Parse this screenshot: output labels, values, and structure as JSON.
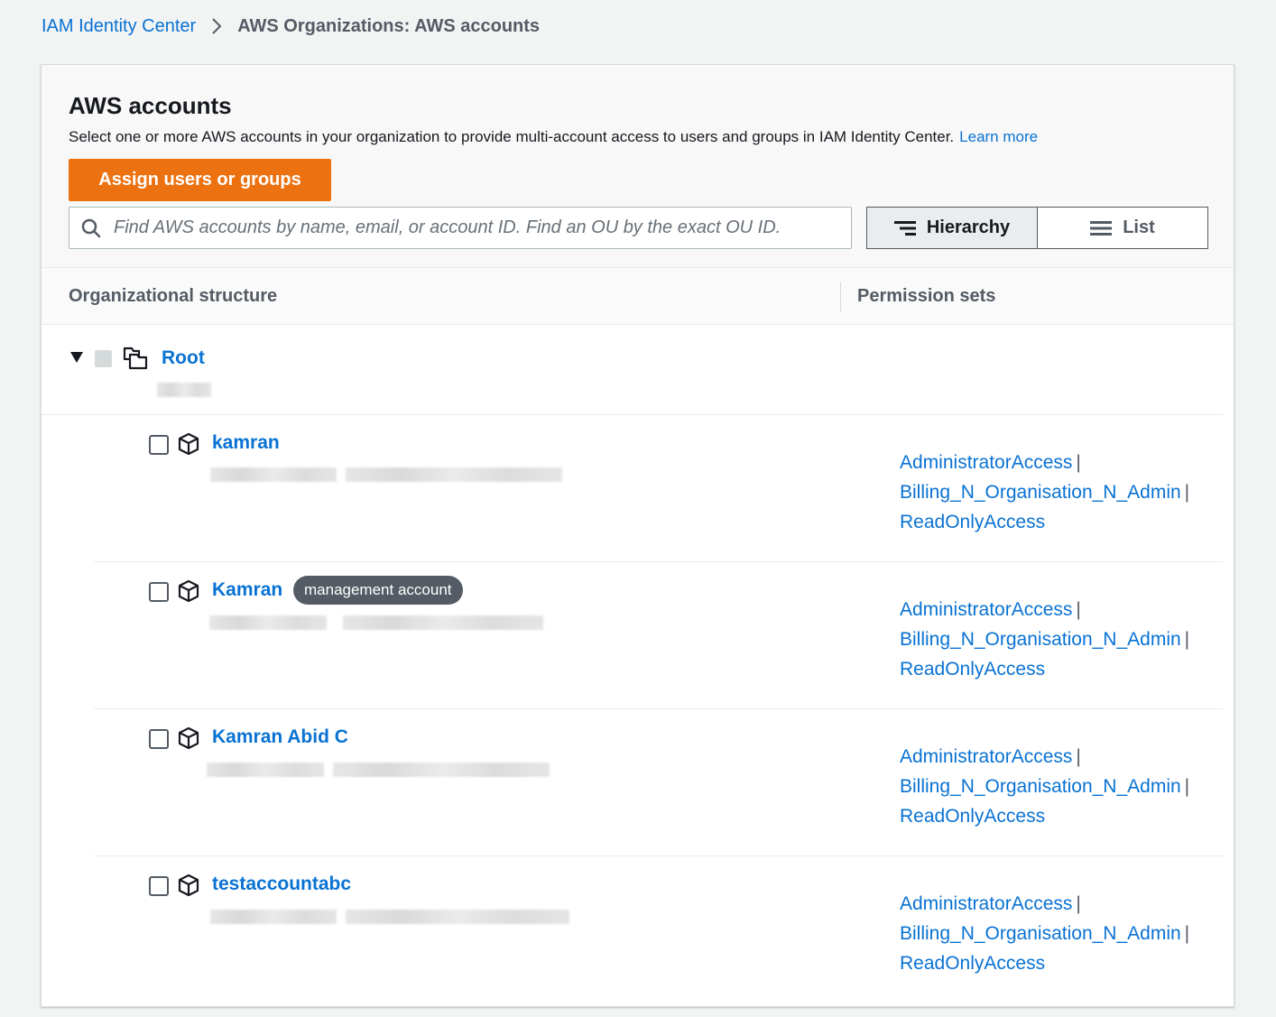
{
  "breadcrumb": {
    "root": "IAM Identity Center",
    "current": "AWS Organizations: AWS accounts"
  },
  "panel": {
    "title": "AWS accounts",
    "description": "Select one or more AWS accounts in your organization to provide multi-account access to users and groups in IAM Identity Center.",
    "learn_more": "Learn more",
    "assign_button": "Assign users or groups",
    "search_placeholder": "Find AWS accounts by name, email, or account ID. Find an OU by the exact OU ID.",
    "view_toggle": {
      "hierarchy": "Hierarchy",
      "list": "List",
      "selected": "Hierarchy"
    }
  },
  "columns": {
    "org_structure": "Organizational structure",
    "permission_sets": "Permission sets"
  },
  "root": {
    "name": "Root",
    "expanded": true
  },
  "accounts": [
    {
      "name": "kamran",
      "badge": "",
      "permission_sets": [
        "AdministratorAccess",
        "Billing_N_Organisation_N_Admin",
        "ReadOnlyAccess"
      ]
    },
    {
      "name": "Kamran",
      "badge": "management account",
      "permission_sets": [
        "AdministratorAccess",
        "Billing_N_Organisation_N_Admin",
        "ReadOnlyAccess"
      ]
    },
    {
      "name": "Kamran Abid C",
      "badge": "",
      "permission_sets": [
        "AdministratorAccess",
        "Billing_N_Organisation_N_Admin",
        "ReadOnlyAccess"
      ]
    },
    {
      "name": "testaccountabc",
      "badge": "",
      "permission_sets": [
        "AdministratorAccess",
        "Billing_N_Organisation_N_Admin",
        "ReadOnlyAccess"
      ]
    }
  ],
  "permission_separator": "|",
  "colors": {
    "link": "#0972d3",
    "primary_button": "#ec7211",
    "badge": "#545b64"
  }
}
